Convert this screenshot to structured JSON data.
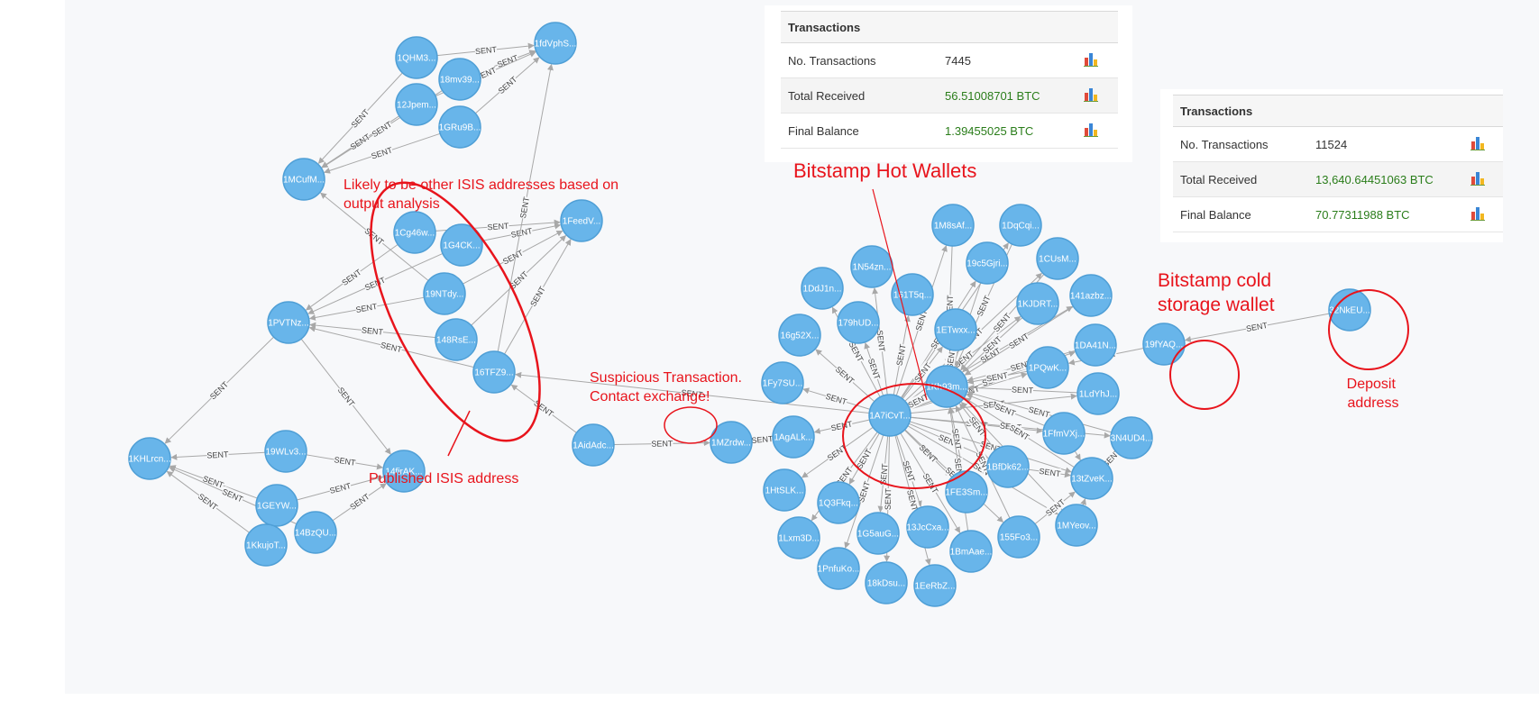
{
  "panel1": {
    "header": "Transactions",
    "rows": [
      {
        "label": "No. Transactions",
        "value": "7445",
        "green": false
      },
      {
        "label": "Total Received",
        "value": "56.51008701 BTC",
        "green": true
      },
      {
        "label": "Final Balance",
        "value": "1.39455025 BTC",
        "green": true
      }
    ]
  },
  "panel2": {
    "header": "Transactions",
    "rows": [
      {
        "label": "No. Transactions",
        "value": "11524",
        "green": false
      },
      {
        "label": "Total Received",
        "value": "13,640.64451063 BTC",
        "green": true
      },
      {
        "label": "Final Balance",
        "value": "70.77311988 BTC",
        "green": true
      }
    ]
  },
  "annotations": {
    "likely_isis": [
      "Likely to be other ISIS addresses based on",
      "output analysis"
    ],
    "published_isis": "Published ISIS address",
    "suspicious": [
      "Suspicious Transaction.",
      "Contact exchange!"
    ],
    "hot_wallets": "Bitstamp Hot Wallets",
    "cold_storage": [
      "Bitstamp cold",
      "storage wallet"
    ],
    "deposit": [
      "Deposit",
      "address"
    ]
  },
  "edge_label": "SENT",
  "nodes": [
    {
      "id": "a1",
      "label": "1QHM3..."
    },
    {
      "id": "a2",
      "label": "1fdVphS..."
    },
    {
      "id": "a3",
      "label": "18mv39..."
    },
    {
      "id": "a4",
      "label": "12Jpem..."
    },
    {
      "id": "a5",
      "label": "1GRu9B..."
    },
    {
      "id": "a6",
      "label": "1MCufM..."
    },
    {
      "id": "b1",
      "label": "1Cg46w..."
    },
    {
      "id": "b2",
      "label": "1G4CK..."
    },
    {
      "id": "b3",
      "label": "1FeedV..."
    },
    {
      "id": "b4",
      "label": "19NTdy..."
    },
    {
      "id": "b5",
      "label": "148RsE..."
    },
    {
      "id": "b6",
      "label": "16TFZ9..."
    },
    {
      "id": "c1",
      "label": "1PVTNz..."
    },
    {
      "id": "c2",
      "label": "1KHLrcn..."
    },
    {
      "id": "c3",
      "label": "19WLv3..."
    },
    {
      "id": "c4",
      "label": "14firAK..."
    },
    {
      "id": "c5",
      "label": "1GEYW..."
    },
    {
      "id": "c6",
      "label": "14BzQU..."
    },
    {
      "id": "c7",
      "label": "1KkujoT..."
    },
    {
      "id": "d1",
      "label": "1AidAdc..."
    },
    {
      "id": "d2",
      "label": "1MZrdw..."
    },
    {
      "id": "h0",
      "label": "1A7iCvT..."
    },
    {
      "id": "h1",
      "label": "1Kh93m..."
    },
    {
      "id": "h2",
      "label": "1M8sAf..."
    },
    {
      "id": "h3",
      "label": "1DqCqi..."
    },
    {
      "id": "h4",
      "label": "19c5Gjri..."
    },
    {
      "id": "h5",
      "label": "1CUsM..."
    },
    {
      "id": "h6",
      "label": "1N54zn..."
    },
    {
      "id": "h7",
      "label": "1DdJ1n..."
    },
    {
      "id": "h8",
      "label": "161T5q..."
    },
    {
      "id": "h9",
      "label": "1KJDRT..."
    },
    {
      "id": "h10",
      "label": "141azbz..."
    },
    {
      "id": "h11",
      "label": "179hUD..."
    },
    {
      "id": "h12",
      "label": "1ETwxx..."
    },
    {
      "id": "h13",
      "label": "16g52X..."
    },
    {
      "id": "h14",
      "label": "1DA41N..."
    },
    {
      "id": "h15",
      "label": "1PQwK..."
    },
    {
      "id": "h16",
      "label": "1Fy7SU..."
    },
    {
      "id": "h17",
      "label": "1LdYhJ..."
    },
    {
      "id": "h18",
      "label": "1AgALk..."
    },
    {
      "id": "h19",
      "label": "1FfmVXj..."
    },
    {
      "id": "h20",
      "label": "3N4UD4..."
    },
    {
      "id": "h21",
      "label": "1BfDk62..."
    },
    {
      "id": "h22",
      "label": "13tZveK..."
    },
    {
      "id": "h23",
      "label": "1HtSLK..."
    },
    {
      "id": "h24",
      "label": "1Q3Fkq..."
    },
    {
      "id": "h25",
      "label": "1FE3Sm..."
    },
    {
      "id": "h26",
      "label": "1MYeov..."
    },
    {
      "id": "h27",
      "label": "1Lxm3D..."
    },
    {
      "id": "h28",
      "label": "1G5auG..."
    },
    {
      "id": "h29",
      "label": "13JcCxa..."
    },
    {
      "id": "h30",
      "label": "1BmAae..."
    },
    {
      "id": "h31",
      "label": "155Fo3..."
    },
    {
      "id": "h32",
      "label": "1PnfuKo..."
    },
    {
      "id": "h33",
      "label": "18kDsu..."
    },
    {
      "id": "h34",
      "label": "1EeRbZ..."
    },
    {
      "id": "e1",
      "label": "19fYAQ..."
    },
    {
      "id": "e2",
      "label": "32NkEU..."
    }
  ],
  "colors": {
    "node": "#68b5ea",
    "node_stroke": "#4f9fd6",
    "edge": "#a8a8a8",
    "annotation": "#e8141c"
  }
}
